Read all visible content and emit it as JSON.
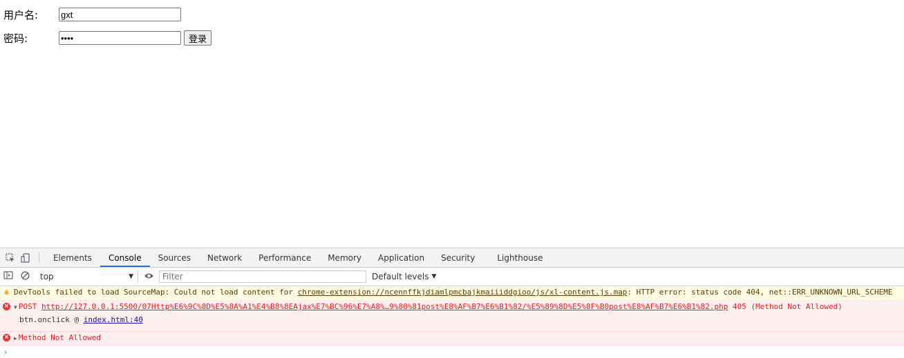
{
  "form": {
    "username_label": "用户名:",
    "username_value": "gxt",
    "password_label": "密码:",
    "password_value": "••••",
    "login_button": "登录"
  },
  "devtools": {
    "tabs": [
      "Elements",
      "Console",
      "Sources",
      "Network",
      "Performance",
      "Memory",
      "Application",
      "Security",
      "Lighthouse"
    ],
    "active_tab": "Console",
    "icons": {
      "inspect": "inspect-icon",
      "device": "device-toggle-icon",
      "sidebar": "sidebar-toggle-icon",
      "clear": "clear-console-icon",
      "eye": "live-expression-icon"
    },
    "toolbar": {
      "context": "top",
      "filter_placeholder": "Filter",
      "levels": "Default levels"
    },
    "messages": {
      "warning": {
        "prefix": "DevTools failed to load SourceMap: Could not load content for ",
        "url": "chrome-extension://ncennffkjdiamlpmcbajkmaiiiddgioo/js/xl-content.js.map",
        "suffix": ": HTTP error: status code 404, net::ERR_UNKNOWN_URL_SCHEME"
      },
      "error1": {
        "method": "POST",
        "url": "http://127.0.0.1:5500/07Http%E6%9C%8D%E5%8A%A1%E4%B8%8EAjax%E7%BC%96%E7%A8%…9%80%81post%E8%AF%B7%E6%B1%82/%E5%89%8D%E5%8F%B0post%E8%AF%B7%E6%B1%82.php",
        "status": "405 (Method Not Allowed)",
        "stack_fn": "btn.onclick @ ",
        "stack_link": "index.html:40"
      },
      "error2": {
        "text": "Method Not Allowed"
      }
    },
    "prompt": "›"
  }
}
